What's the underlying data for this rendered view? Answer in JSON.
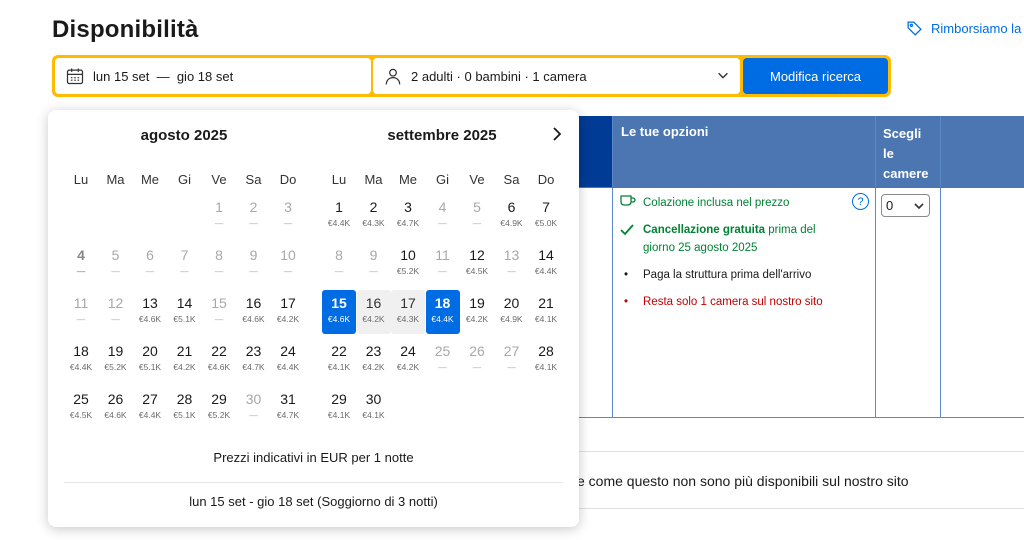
{
  "page": {
    "title": "Disponibilità",
    "refund_link": "Rimborsiamo la"
  },
  "search": {
    "dates": "lun 15 set  —  gio 18 set",
    "guests": "2 adulti · 0 bambini · 1 camera",
    "submit": "Modifica ricerca"
  },
  "table": {
    "col_options": "Le tue opzioni",
    "col_rooms_lines": [
      "Scegli",
      "le",
      "camere"
    ],
    "options": {
      "breakfast": "Colazione inclusa nel prezzo",
      "cancel_bold": "Cancellazione gratuita",
      "cancel_rest_1": " prima del",
      "cancel_rest_2": "giorno 25 agosto 2025",
      "pay": "Paga la struttura prima dell'arrivo",
      "last_room": "Resta solo 1 camera sul nostro sito"
    },
    "rooms_select_value": "0",
    "unavailable_text": "e come questo non sono più disponibili sul nostro sito"
  },
  "calendar": {
    "weekdays": [
      "Lu",
      "Ma",
      "Me",
      "Gi",
      "Ve",
      "Sa",
      "Do"
    ],
    "note": "Prezzi indicativi in EUR per 1 notte",
    "selected_range": "lun 15 set - gio 18 set (Soggiorno di 3 notti)",
    "months": [
      {
        "title": "agosto 2025",
        "rows": [
          [
            null,
            null,
            null,
            null,
            {
              "d": "1",
              "p": "—",
              "s": "dis"
            },
            {
              "d": "2",
              "p": "—",
              "s": "dis"
            },
            {
              "d": "3",
              "p": "—",
              "s": "dis"
            }
          ],
          [
            {
              "d": "4",
              "p": "—",
              "s": "bold"
            },
            {
              "d": "5",
              "p": "—",
              "s": "dis"
            },
            {
              "d": "6",
              "p": "—",
              "s": "dis"
            },
            {
              "d": "7",
              "p": "—",
              "s": "dis"
            },
            {
              "d": "8",
              "p": "—",
              "s": "dis"
            },
            {
              "d": "9",
              "p": "—",
              "s": "dis"
            },
            {
              "d": "10",
              "p": "—",
              "s": "dis"
            }
          ],
          [
            {
              "d": "11",
              "p": "—",
              "s": "dis"
            },
            {
              "d": "12",
              "p": "—",
              "s": "dis"
            },
            {
              "d": "13",
              "p": "€4.6K",
              "s": ""
            },
            {
              "d": "14",
              "p": "€5.1K",
              "s": ""
            },
            {
              "d": "15",
              "p": "—",
              "s": "dis"
            },
            {
              "d": "16",
              "p": "€4.6K",
              "s": ""
            },
            {
              "d": "17",
              "p": "€4.2K",
              "s": ""
            }
          ],
          [
            {
              "d": "18",
              "p": "€4.4K",
              "s": ""
            },
            {
              "d": "19",
              "p": "€5.2K",
              "s": ""
            },
            {
              "d": "20",
              "p": "€5.1K",
              "s": ""
            },
            {
              "d": "21",
              "p": "€4.2K",
              "s": ""
            },
            {
              "d": "22",
              "p": "€4.6K",
              "s": ""
            },
            {
              "d": "23",
              "p": "€4.7K",
              "s": ""
            },
            {
              "d": "24",
              "p": "€4.4K",
              "s": ""
            }
          ],
          [
            {
              "d": "25",
              "p": "€4.5K",
              "s": ""
            },
            {
              "d": "26",
              "p": "€4.6K",
              "s": ""
            },
            {
              "d": "27",
              "p": "€4.4K",
              "s": ""
            },
            {
              "d": "28",
              "p": "€5.1K",
              "s": ""
            },
            {
              "d": "29",
              "p": "€5.2K",
              "s": ""
            },
            {
              "d": "30",
              "p": "—",
              "s": "dis"
            },
            {
              "d": "31",
              "p": "€4.7K",
              "s": ""
            }
          ]
        ]
      },
      {
        "title": "settembre 2025",
        "rows": [
          [
            {
              "d": "1",
              "p": "€4.4K",
              "s": ""
            },
            {
              "d": "2",
              "p": "€4.3K",
              "s": ""
            },
            {
              "d": "3",
              "p": "€4.7K",
              "s": ""
            },
            {
              "d": "4",
              "p": "—",
              "s": "dis"
            },
            {
              "d": "5",
              "p": "—",
              "s": "dis"
            },
            {
              "d": "6",
              "p": "€4.9K",
              "s": ""
            },
            {
              "d": "7",
              "p": "€5.0K",
              "s": ""
            }
          ],
          [
            {
              "d": "8",
              "p": "—",
              "s": "dis"
            },
            {
              "d": "9",
              "p": "—",
              "s": "dis"
            },
            {
              "d": "10",
              "p": "€5.2K",
              "s": ""
            },
            {
              "d": "11",
              "p": "—",
              "s": "dis"
            },
            {
              "d": "12",
              "p": "€4.5K",
              "s": ""
            },
            {
              "d": "13",
              "p": "—",
              "s": "dis"
            },
            {
              "d": "14",
              "p": "€4.4K",
              "s": ""
            }
          ],
          [
            {
              "d": "15",
              "p": "€4.6K",
              "s": "sel"
            },
            {
              "d": "16",
              "p": "€4.2K",
              "s": "range"
            },
            {
              "d": "17",
              "p": "€4.3K",
              "s": "range"
            },
            {
              "d": "18",
              "p": "€4.4K",
              "s": "sel"
            },
            {
              "d": "19",
              "p": "€4.2K",
              "s": ""
            },
            {
              "d": "20",
              "p": "€4.9K",
              "s": ""
            },
            {
              "d": "21",
              "p": "€4.1K",
              "s": ""
            }
          ],
          [
            {
              "d": "22",
              "p": "€4.1K",
              "s": ""
            },
            {
              "d": "23",
              "p": "€4.2K",
              "s": ""
            },
            {
              "d": "24",
              "p": "€4.2K",
              "s": ""
            },
            {
              "d": "25",
              "p": "—",
              "s": "dis"
            },
            {
              "d": "26",
              "p": "—",
              "s": "dis"
            },
            {
              "d": "27",
              "p": "—",
              "s": "dis"
            },
            {
              "d": "28",
              "p": "€4.1K",
              "s": ""
            }
          ],
          [
            {
              "d": "29",
              "p": "€4.1K",
              "s": ""
            },
            {
              "d": "30",
              "p": "€4.1K",
              "s": ""
            },
            null,
            null,
            null,
            null,
            null
          ]
        ]
      }
    ]
  },
  "colors": {
    "brand_blue": "#006ce4",
    "search_border": "#febb02",
    "table_header": "#4c76b2",
    "table_header_dark": "#003b95",
    "green": "#008234",
    "red": "#c00000"
  },
  "icons": [
    "price-tag-icon",
    "calendar-icon",
    "person-icon",
    "chevron-down-icon",
    "chevron-right-icon",
    "coffee-cup-icon",
    "check-icon",
    "help-icon"
  ]
}
